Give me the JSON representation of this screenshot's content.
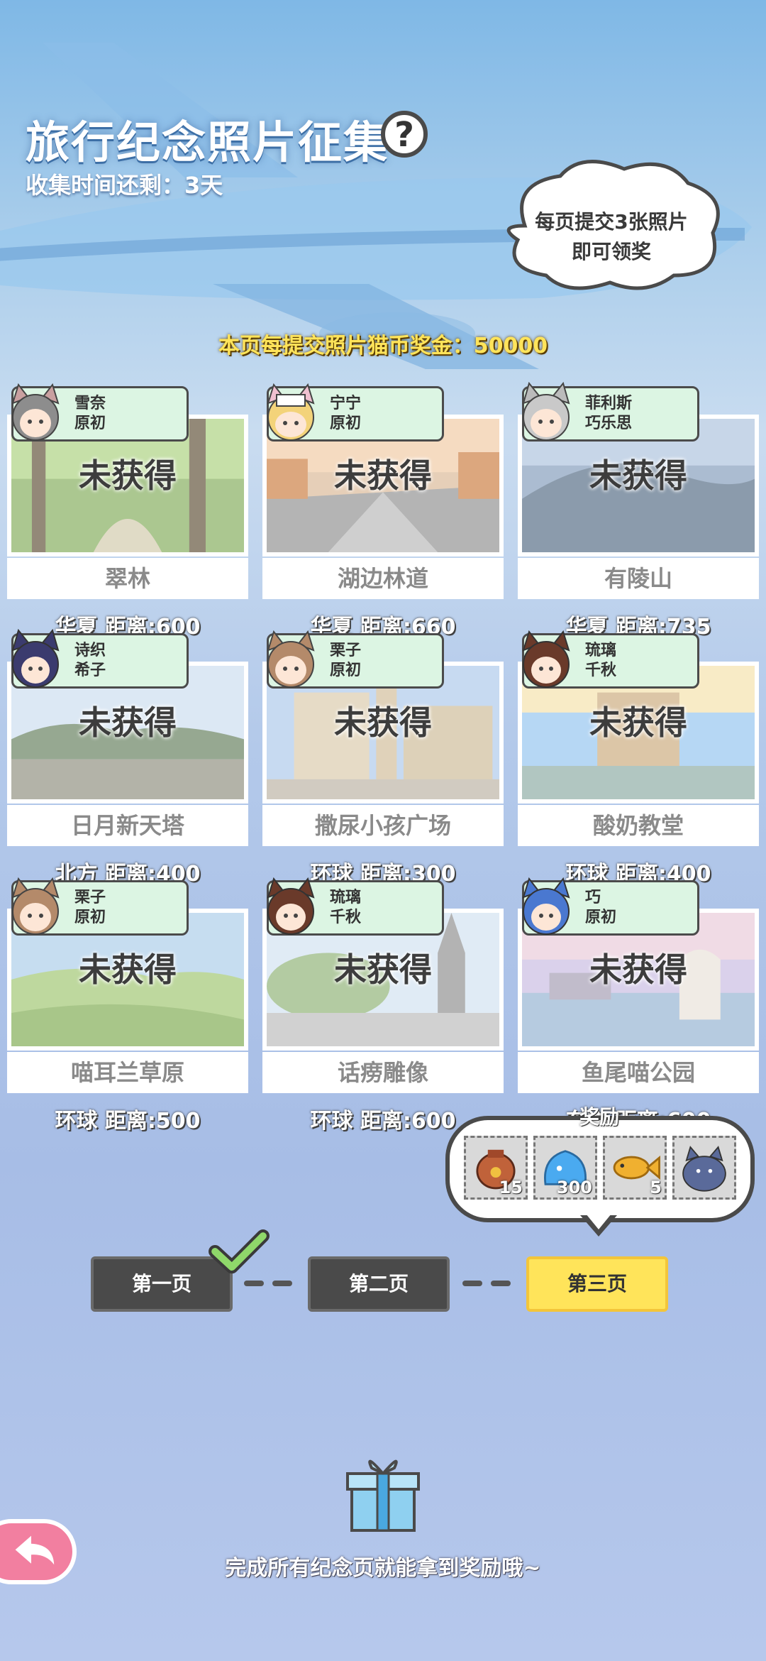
{
  "header": {
    "title": "旅行纪念照片征集",
    "help_symbol": "?",
    "timer": "收集时间还剩：3天"
  },
  "hint_bubble": {
    "line1": "每页提交3张照片",
    "line2": "即可领奖"
  },
  "bonus_text": "本页每提交照片猫币奖金：50000",
  "cards": [
    {
      "char1": "雪奈",
      "char2": "原初",
      "status": "未获得",
      "distance": "华夏  距离:600",
      "name": "翠林"
    },
    {
      "char1": "宁宁",
      "char2": "原初",
      "status": "未获得",
      "distance": "华夏  距离:660",
      "name": "湖边林道"
    },
    {
      "char1": "菲利斯",
      "char2": "巧乐思",
      "status": "未获得",
      "distance": "华夏  距离:735",
      "name": "有陵山"
    },
    {
      "char1": "诗织",
      "char2": "希子",
      "status": "未获得",
      "distance": "北方  距离:400",
      "name": "日月新天塔"
    },
    {
      "char1": "栗子",
      "char2": "原初",
      "status": "未获得",
      "distance": "环球  距离:300",
      "name": "撒尿小孩广场"
    },
    {
      "char1": "琉璃",
      "char2": "千秋",
      "status": "未获得",
      "distance": "环球  距离:400",
      "name": "酸奶教堂"
    },
    {
      "char1": "栗子",
      "char2": "原初",
      "status": "未获得",
      "distance": "环球  距离:500",
      "name": "喵耳兰草原"
    },
    {
      "char1": "琉璃",
      "char2": "千秋",
      "status": "未获得",
      "distance": "环球  距离:600",
      "name": "话痨雕像"
    },
    {
      "char1": "巧",
      "char2": "原初",
      "status": "未获得",
      "distance": "东方  距离:600",
      "name": "鱼尾喵公园"
    }
  ],
  "rewards": {
    "title": "奖励",
    "items": [
      {
        "icon": "treasure-bag-icon",
        "count": "15"
      },
      {
        "icon": "blue-slime-icon",
        "count": "300"
      },
      {
        "icon": "golden-fish-icon",
        "count": "5"
      },
      {
        "icon": "cat-plush-icon",
        "count": ""
      }
    ]
  },
  "pages": {
    "page1": "第一页",
    "page2": "第二页",
    "page3": "第三页"
  },
  "footer": "完成所有纪念页就能拿到奖励哦~",
  "colors": {
    "active_page": "#ffe45a",
    "card_tag": "#dcf5e3",
    "back_button": "#f27fa0"
  }
}
